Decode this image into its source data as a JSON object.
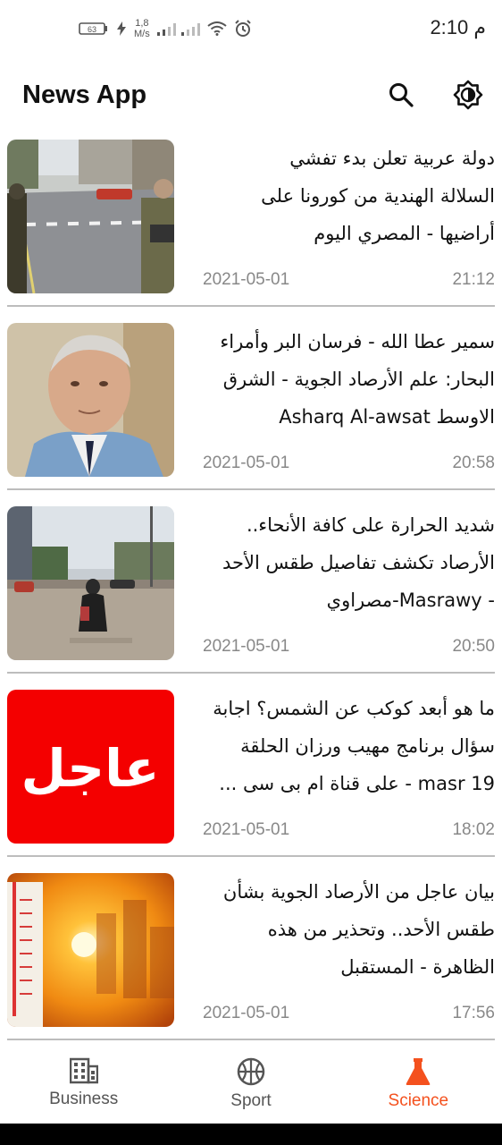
{
  "status_bar": {
    "time": "2:10 م",
    "battery": "63",
    "net_speed_value": "1,8",
    "net_speed_unit": "M/s"
  },
  "app_bar": {
    "title": "News App",
    "search_icon": "search-icon",
    "theme_icon": "brightness-icon"
  },
  "articles": [
    {
      "title_lines": [
        "دولة عربية تعلن بدء تفشي",
        "السلالة الهندية من كورونا على",
        "أراضيها - المصري اليوم"
      ],
      "date": "2021-05-01",
      "time": "21:12",
      "image": "soldiers-street-photo"
    },
    {
      "title_lines": [
        "سمير عطا الله - فرسان البر وأمراء",
        "البحار: علم الأرصاد الجوية - الشرق",
        "الاوسط Asharq Al-awsat"
      ],
      "date": "2021-05-01",
      "time": "20:58",
      "image": "man-portrait-photo"
    },
    {
      "title_lines": [
        "شديد الحرارة على كافة الأنحاء..",
        "الأرصاد تكشف تفاصيل طقس الأحد",
        "- Masrawy-مصراوي"
      ],
      "date": "2021-05-01",
      "time": "20:50",
      "image": "street-woman-photo"
    },
    {
      "title_lines": [
        "ما هو أبعد كوكب عن الشمس؟ اجابة",
        "سؤال برنامج مهيب ورزان الحلقة",
        "19 masr - على قناة ام بى سى ..."
      ],
      "date": "2021-05-01",
      "time": "18:02",
      "image": "breaking-news-banner",
      "image_text": "عاجل"
    },
    {
      "title_lines": [
        "بيان عاجل من الأرصاد الجوية بشأن",
        "طقس الأحد.. وتحذير من هذه",
        "الظاهرة - المستقبل"
      ],
      "date": "2021-05-01",
      "time": "17:56",
      "image": "thermometer-sun-photo"
    }
  ],
  "bottom_nav": [
    {
      "label": "Business",
      "icon": "building-icon",
      "active": false
    },
    {
      "label": "Sport",
      "icon": "basketball-icon",
      "active": false
    },
    {
      "label": "Science",
      "icon": "flask-icon",
      "active": true
    }
  ],
  "colors": {
    "accent": "#f4511e",
    "inactive": "#555555",
    "divider": "#bdbdbd",
    "meta_text": "#888888"
  }
}
